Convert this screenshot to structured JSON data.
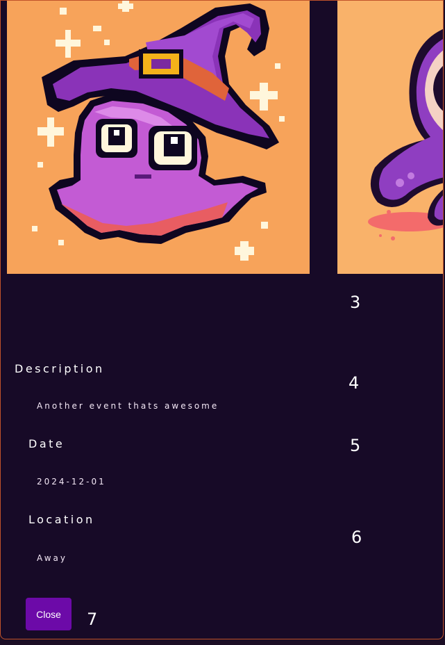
{
  "modal": {
    "images": [
      {
        "name": "octopus-wizard-pixel-art"
      },
      {
        "name": "purple-octopus-cartoon"
      }
    ],
    "slide_numbers": [
      "3",
      "4",
      "5",
      "6",
      "7"
    ],
    "description": {
      "label": "Description",
      "value": "Another event thats awesome"
    },
    "date": {
      "label": "Date",
      "value": "2024-12-01"
    },
    "location": {
      "label": "Location",
      "value": "Away"
    },
    "close_button": {
      "label": "Close"
    }
  },
  "colors": {
    "background": "#170a27",
    "border": "#c0522a",
    "button": "#6c0aa8",
    "image_bg": "#f7a35a"
  }
}
